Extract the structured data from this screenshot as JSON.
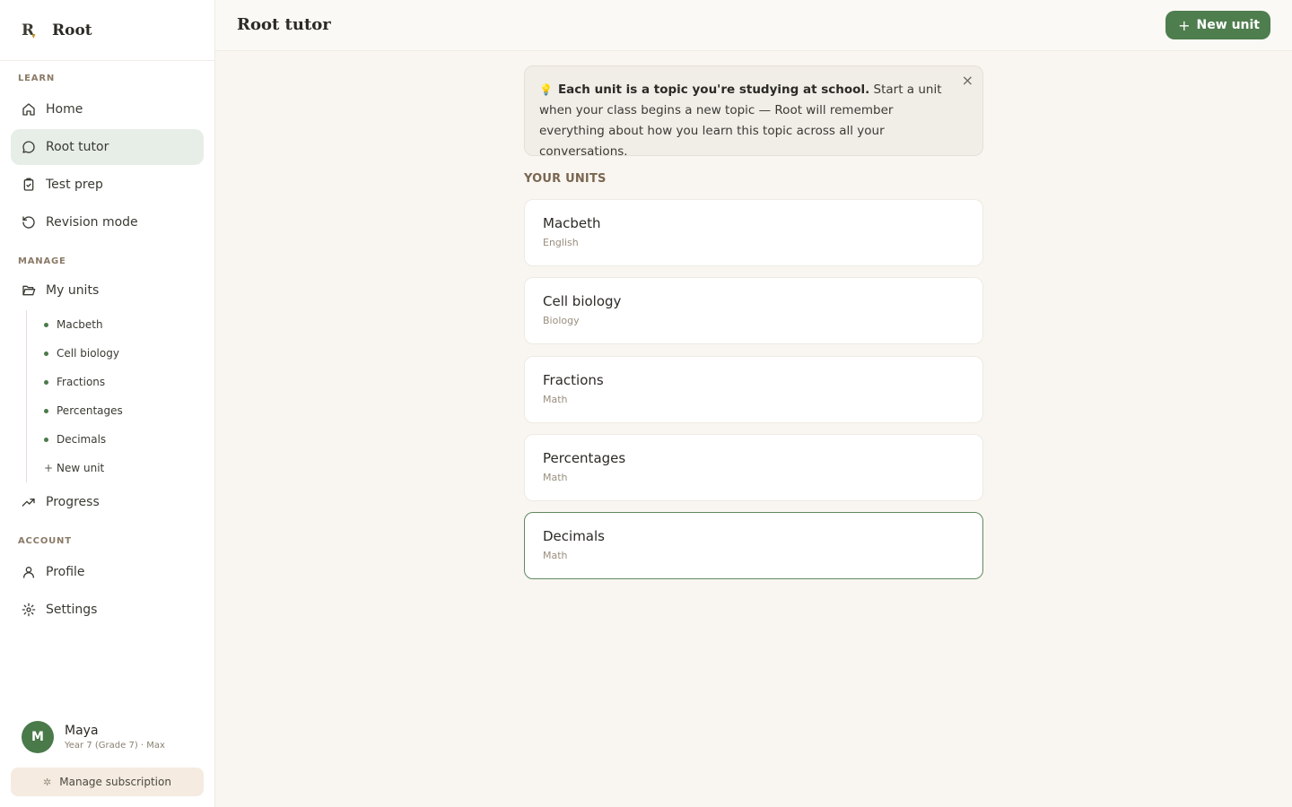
{
  "app": {
    "name": "Root",
    "logo_letter": "R"
  },
  "sidebar": {
    "learn_label": "LEARN",
    "learn_items": [
      {
        "label": "Home",
        "icon": "home-icon"
      },
      {
        "label": "Root tutor",
        "icon": "chat-bubble-icon",
        "active": true
      },
      {
        "label": "Test prep",
        "icon": "clipboard-check-icon"
      },
      {
        "label": "Revision mode",
        "icon": "rotate-ccw-icon"
      }
    ],
    "manage_label": "MANAGE",
    "my_units_label": "My units",
    "unit_links": [
      "Macbeth",
      "Cell biology",
      "Fractions",
      "Percentages",
      "Decimals"
    ],
    "new_unit_link": "New unit",
    "progress_label": "Progress",
    "account_label": "ACCOUNT",
    "profile_label": "Profile",
    "settings_label": "Settings"
  },
  "user": {
    "initial": "M",
    "name": "Maya",
    "meta": "Year 7 (Grade 7) · Max"
  },
  "manage_subscription": "Manage subscription",
  "header": {
    "title": "Root tutor",
    "new_unit_label": "New unit"
  },
  "banner": {
    "bold": "Each unit is a topic you're studying at school.",
    "text": " Start a unit when your class begins a new topic — Root will remember everything about how you learn this topic across all your conversations.",
    "close": "×"
  },
  "units": {
    "heading": "YOUR UNITS",
    "items": [
      {
        "name": "Macbeth",
        "subject": "English"
      },
      {
        "name": "Cell biology",
        "subject": "Biology"
      },
      {
        "name": "Fractions",
        "subject": "Math"
      },
      {
        "name": "Percentages",
        "subject": "Math"
      },
      {
        "name": "Decimals",
        "subject": "Math",
        "selected": true
      }
    ]
  },
  "colors": {
    "accent": "#4e7d4e",
    "active_nav": "#e7eee7",
    "background": "#f9f6f1"
  }
}
